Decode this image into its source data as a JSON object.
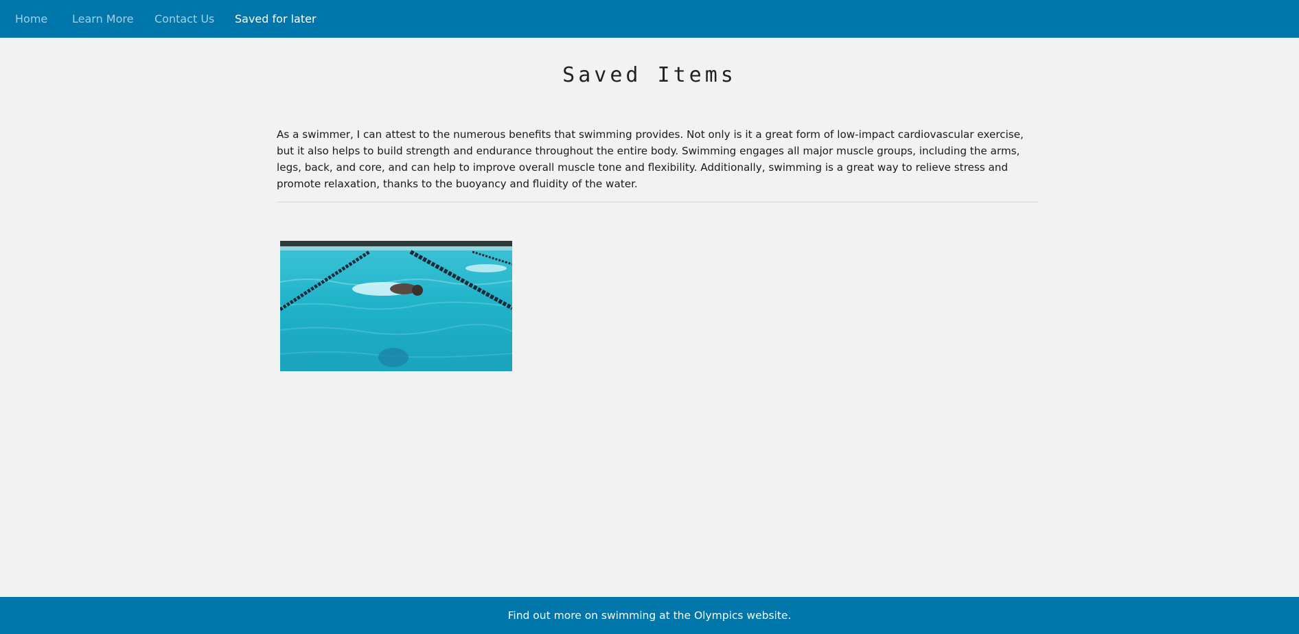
{
  "nav": {
    "items": [
      {
        "label": "Home"
      },
      {
        "label": "Learn More"
      },
      {
        "label": "Contact Us"
      },
      {
        "label": "Saved for later"
      }
    ],
    "active_index": 3,
    "background": "#0076aa"
  },
  "main": {
    "title": "Saved Items",
    "intro": "As a swimmer, I can attest to the numerous benefits that swimming provides. Not only is it a great form of low-impact cardiovascular exercise, but it also helps to build strength and endurance throughout the entire body. Swimming engages all major muscle groups, including the arms, legs, back, and core, and can help to improve overall muscle tone and flexibility. Additionally, swimming is a great way to relieve stress and promote relaxation, thanks to the buoyancy and fluidity of the water.",
    "saved_items": [
      {
        "image": "swimmer-in-pool-photo"
      }
    ]
  },
  "footer": {
    "text": "Find out more on swimming at the Olympics website."
  }
}
